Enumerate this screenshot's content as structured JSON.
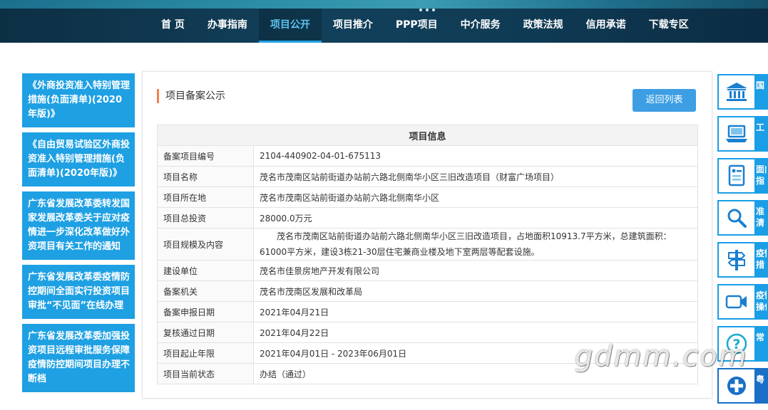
{
  "nav": {
    "items": [
      "首 页",
      "办事指南",
      "项目公开",
      "项目推介",
      "PPP项目",
      "中介服务",
      "政策法规",
      "信用承诺",
      "下载专区"
    ],
    "active_index": 2
  },
  "sidebar": {
    "items": [
      "《外商投资准入特别管理措施(负面清单)(2020年版)》",
      "《自由贸易试验区外商投资准入特别管理措施(负面清单)(2020年版)》",
      "广东省发展改革委转发国家发展改革委关于应对疫情进一步深化改革做好外资项目有关工作的通知",
      "广东省发展改革委疫情防控期间全面实行投资项目审批“不见面”在线办理",
      "广东省发展改革委加强投资项目远程审批服务保障疫情防控期间项目办理不断档"
    ]
  },
  "panel": {
    "title": "项目备案公示",
    "back_button": "返回列表",
    "table_header": "项目信息",
    "rows": [
      {
        "label": "备案项目编号",
        "value": "2104-440902-04-01-675113"
      },
      {
        "label": "项目名称",
        "value": "茂名市茂南区站前街道办站前六路北侧南华小区三旧改造项目（财富广场项目）"
      },
      {
        "label": "项目所在地",
        "value": "茂名市茂南区站前街道办站前六路北侧南华小区"
      },
      {
        "label": "项目总投资",
        "value": "28000.0万元"
      },
      {
        "label": "项目规模及内容",
        "value": "茂名市茂南区站前街道办站前六路北侧南华小区三旧改造项目，占地面积10913.7平方米，总建筑面积：61000平方米，建设3栋21-30层住宅兼商业楼及地下室两层等配套设施。"
      },
      {
        "label": "建设单位",
        "value": "茂名市佳景房地产开发有限公司"
      },
      {
        "label": "备案机关",
        "value": "茂名市茂南区发展和改革局"
      },
      {
        "label": "备案申报日期",
        "value": "2021年04月21日"
      },
      {
        "label": "复核通过日期",
        "value": "2021年04月22日"
      },
      {
        "label": "项目起止年限",
        "value": "2021年04月01日 - 2023年06月01日"
      },
      {
        "label": "项目当前状态",
        "value": "办结（通过）"
      }
    ]
  },
  "quick_links": [
    {
      "label": "国",
      "icon": "government-building-icon"
    },
    {
      "label": "工",
      "icon": "laptop-icon"
    },
    {
      "label": "面向\n指",
      "icon": "document-list-icon"
    },
    {
      "label": "准\n清",
      "icon": "search-icon"
    },
    {
      "label": "疫情\n措",
      "icon": "signpost-icon"
    },
    {
      "label": "疫情\n操作",
      "icon": "video-camera-icon"
    },
    {
      "label": "常",
      "icon": "question-icon"
    },
    {
      "label": "粤",
      "icon": "medical-cross-icon"
    }
  ],
  "watermark": "gdmm.com",
  "colors": {
    "nav_bg": "#0f3a54",
    "accent": "#1ea0e3",
    "title_bar": "#f08050"
  }
}
